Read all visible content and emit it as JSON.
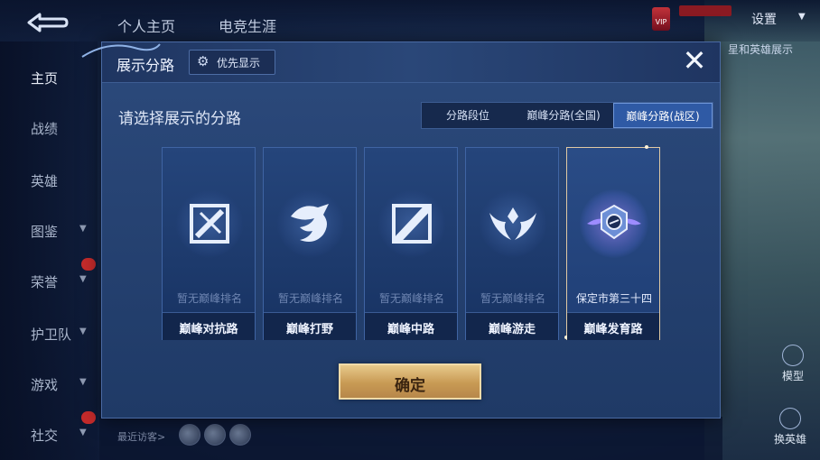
{
  "top_nav": {
    "tabs": [
      "个人主页",
      "电竞生涯"
    ],
    "settings_label": "设置",
    "right_subtext": "星和英雄展示"
  },
  "sidebar": {
    "items": [
      {
        "label": "主页",
        "has_chevron": false
      },
      {
        "label": "战绩",
        "has_chevron": false
      },
      {
        "label": "英雄",
        "has_chevron": false
      },
      {
        "label": "图鉴",
        "has_chevron": true
      },
      {
        "label": "荣誉",
        "has_chevron": true
      },
      {
        "label": "护卫队",
        "has_chevron": true
      },
      {
        "label": "游戏",
        "has_chevron": true
      },
      {
        "label": "社交",
        "has_chevron": true
      }
    ]
  },
  "right_panel": {
    "model_label": "模型",
    "swap_hero_label": "换英雄"
  },
  "bottom": {
    "visitors_label": "最近访客>"
  },
  "modal": {
    "title": "展示分路",
    "priority_button": "优先显示",
    "close_symbol": "✕",
    "prompt": "请选择展示的分路",
    "filter_tabs": [
      {
        "label": "分路段位",
        "active": false
      },
      {
        "label": "巅峰分路(全国)",
        "active": false
      },
      {
        "label": "巅峰分路(战区)",
        "active": true
      }
    ],
    "cards": [
      {
        "rank_text": "暂无巅峰排名",
        "lane": "巅峰对抗路",
        "icon": "sword-shield-icon",
        "selected": false
      },
      {
        "rank_text": "暂无巅峰排名",
        "lane": "巅峰打野",
        "icon": "dragon-icon",
        "selected": false
      },
      {
        "rank_text": "暂无巅峰排名",
        "lane": "巅峰中路",
        "icon": "staff-icon",
        "selected": false
      },
      {
        "rank_text": "暂无巅峰排名",
        "lane": "巅峰游走",
        "icon": "wings-icon",
        "selected": false
      },
      {
        "rank_text": "保定市第三十四",
        "lane": "巅峰发育路",
        "icon": "winged-crest-icon",
        "selected": true
      }
    ],
    "confirm_button": "确定"
  },
  "colors": {
    "modal_bg": "#24406f",
    "accent_tab": "#2f5aa5",
    "confirm_gold": "#c89a54",
    "selected_border": "#e0c9a3"
  }
}
